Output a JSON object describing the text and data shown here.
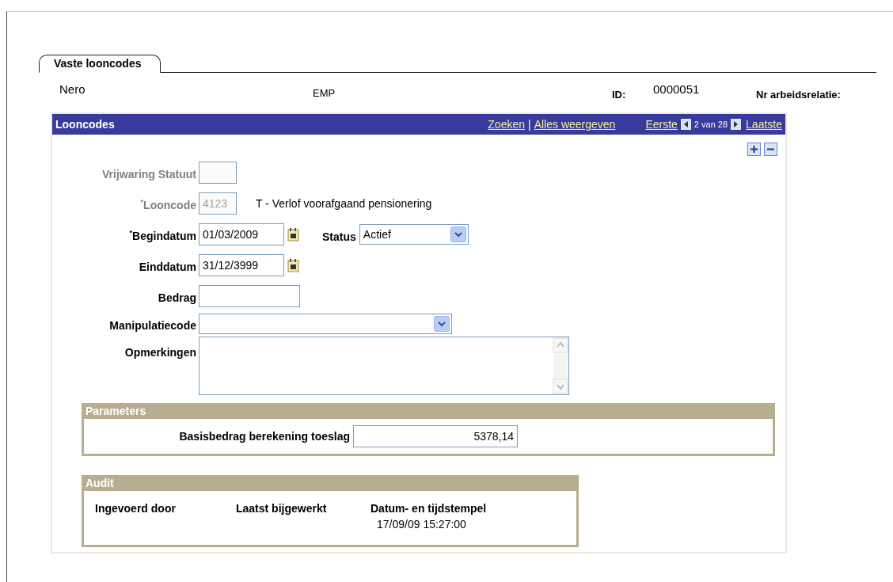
{
  "tab": {
    "label": "Vaste looncodes",
    "selected": true
  },
  "header": {
    "name": "Nero",
    "type": "EMP",
    "id_label": "ID:",
    "id_value": "0000051",
    "relation_label": "Nr arbeidsrelatie:"
  },
  "panel": {
    "title": "Looncodes",
    "links": [
      "Zoeken",
      "Alles weergeven"
    ],
    "separator": "|",
    "first": "Eerste",
    "position": "2 van 28",
    "last": "Laatste"
  },
  "fields": [
    {
      "label": "Vrijwaring Statuut",
      "kind": "code",
      "disabled": true
    },
    {
      "label": "$^{*}$Looncode",
      "kind": "code",
      "disabled": true,
      "value": "4123",
      "description": "T - Verlof voorafgaand pensionering"
    },
    {
      "label": "$^{*}$Begindatum",
      "kind": "date",
      "disabled": false,
      "value": "01/03/2009",
      "extra": {
        "label": "Status",
        "kind": "select",
        "value": "Actief"
      }
    },
    {
      "label": "Einddatum",
      "kind": "date",
      "disabled": false,
      "value": "31/12/3999"
    },
    {
      "label": "Bedrag",
      "kind": "text",
      "disabled": false
    },
    {
      "label": "Manipulatiecode",
      "kind": "select",
      "disabled": false
    },
    {
      "label": "Opmerkingen",
      "kind": "textarea",
      "disabled": false
    }
  ],
  "parameters": {
    "title": "Parameters",
    "rows": [
      {
        "label": "Basisbedrag berekening toeslag",
        "value": "5378,14"
      }
    ]
  },
  "audit": {
    "title": "Audit",
    "columns": [
      {
        "label": "Ingevoerd door"
      },
      {
        "label": "Laatst bijgewerkt"
      },
      {
        "label": "Datum- en tijdstempel",
        "value": "17/09/09 15:27:00"
      }
    ]
  }
}
